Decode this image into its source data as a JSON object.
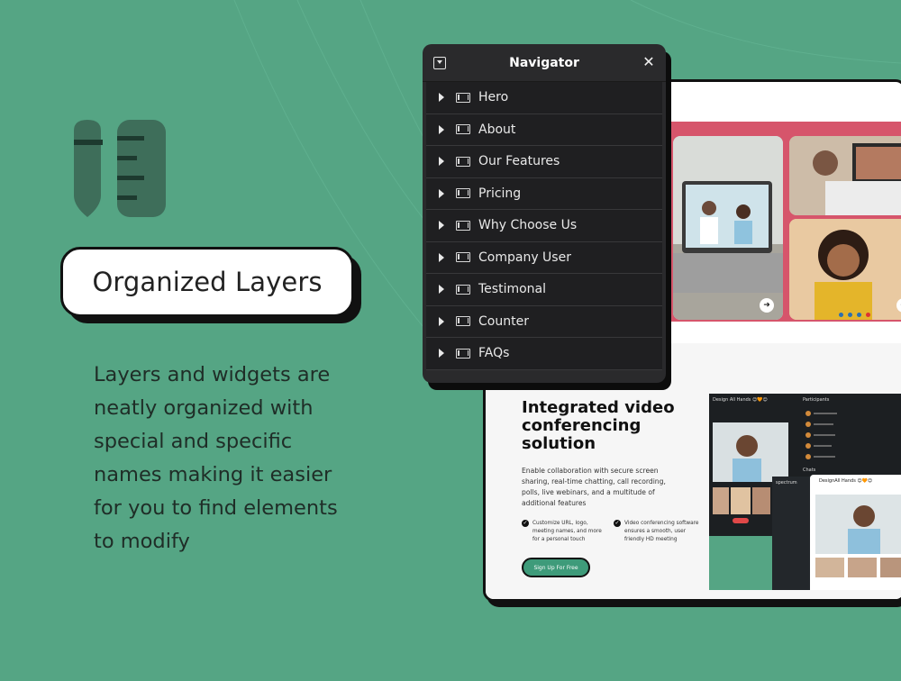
{
  "colors": {
    "background": "#55a584",
    "panel": "#2a2a2c",
    "panel_row": "#1f1f21",
    "accent_pink": "#d6556b",
    "accent_green": "#3e9b7a"
  },
  "promo": {
    "title": "Organized Layers",
    "description": "Layers and widgets are neatly organized with special and specific names making it easier for you to find elements to modify"
  },
  "navigator": {
    "title": "Navigator",
    "toggle_icon": "collapse-icon",
    "close_icon": "close-icon",
    "items": [
      {
        "label": "Hero"
      },
      {
        "label": "About"
      },
      {
        "label": "Our Features"
      },
      {
        "label": "Pricing"
      },
      {
        "label": "Why Choose Us"
      },
      {
        "label": "Company User"
      },
      {
        "label": "Testimonal"
      },
      {
        "label": "Counter"
      },
      {
        "label": "FAQs"
      }
    ]
  },
  "website_preview": {
    "heading": "Integrated video conferencing solution",
    "paragraph": "Enable collaboration with secure screen sharing, real-time chatting, call recording, polls, live webinars, and a multitude of additional features",
    "feature_1": "Customize URL, logo, meeting names, and more for a personal touch",
    "feature_2": "Video conferencing software ensures a smooth, user friendly HD meeting",
    "cta": "Sign Up For Free",
    "app_meeting_title": "Design All Hands 😊🧡😊",
    "app_participants": "Participants",
    "app_brand": "spectrum",
    "app_chat": "Chats",
    "app_meeting_title_2": "DesignAll Hands 😊🧡😊"
  }
}
